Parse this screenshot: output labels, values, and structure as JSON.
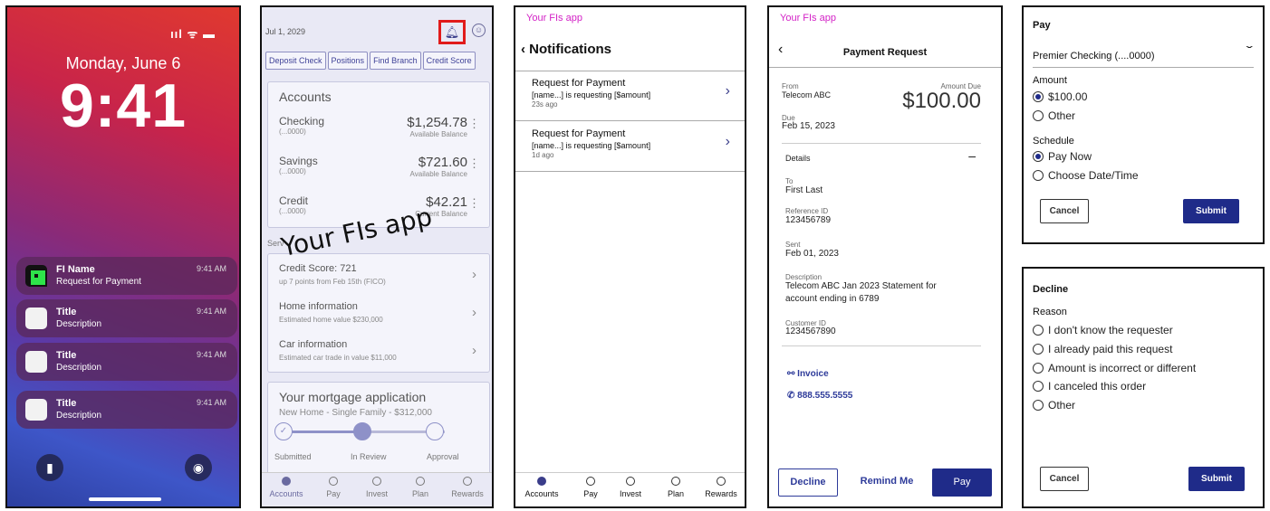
{
  "lock": {
    "status": "ııl ᯤ ▬",
    "date": "Monday, June 6",
    "time": "9:41",
    "notifications": [
      {
        "title": "FI Name",
        "desc": "Request for Payment",
        "time": "9:41 AM"
      },
      {
        "title": "Title",
        "desc": "Description",
        "time": "9:41 AM"
      },
      {
        "title": "Title",
        "desc": "Description",
        "time": "9:41 AM"
      },
      {
        "title": "Title",
        "desc": "Description",
        "time": "9:41 AM"
      }
    ]
  },
  "home": {
    "date": "Jul 1, 2029",
    "chips": [
      "Deposit Check",
      "Positions",
      "Find Branch",
      "Credit Score"
    ],
    "accounts_title": "Accounts",
    "accounts": [
      {
        "name": "Checking",
        "sub": "(...0000)",
        "value": "$1,254.78",
        "label": "Available Balance"
      },
      {
        "name": "Savings",
        "sub": "(...0000)",
        "value": "$721.60",
        "label": "Available Balance"
      },
      {
        "name": "Credit",
        "sub": "(...0000)",
        "value": "$42.21",
        "label": "Current Balance"
      }
    ],
    "services_label": "Serv",
    "services": [
      {
        "name": "Credit Score: 721",
        "sub": "up 7 points from Feb 15th (FICO)"
      },
      {
        "name": "Home information",
        "sub": "Estimated home value $230,000"
      },
      {
        "name": "Car information",
        "sub": "Estimated car trade in value $11,000"
      }
    ],
    "stamp": "Your FIs app",
    "mortgage_title": "Your mortgage application",
    "mortgage_sub": "New Home - Single Family - $312,000",
    "steps": [
      "Submitted",
      "In Review",
      "Approval"
    ],
    "progress": 0.5
  },
  "nav": [
    "Accounts",
    "Pay",
    "Invest",
    "Plan",
    "Rewards"
  ],
  "notifs": {
    "app": "Your FIs app",
    "title": "Notifications",
    "items": [
      {
        "title": "Request for Payment",
        "desc": "[name...] is requesting [$amount]",
        "age": "23s ago"
      },
      {
        "title": "Request for Payment",
        "desc": "[name...] is requesting [$amount]",
        "age": "1d ago"
      }
    ]
  },
  "request": {
    "app": "Your FIs app",
    "title": "Payment Request",
    "from_label": "From",
    "from": "Telecom ABC",
    "amount_label": "Amount Due",
    "amount": "$100.00",
    "due_label": "Due",
    "due": "Feb 15, 2023",
    "details": "Details",
    "to_label": "To",
    "to": "First Last",
    "ref_label": "Reference ID",
    "ref": "123456789",
    "sent_label": "Sent",
    "sent": "Feb 01, 2023",
    "desc_label": "Description",
    "desc1": "Telecom ABC Jan 2023 Statement for",
    "desc2": "account ending in 6789",
    "cust_label": "Customer ID",
    "cust": "1234567890",
    "invoice": "Invoice",
    "phone": "888.555.5555",
    "decline": "Decline",
    "remind": "Remind Me",
    "pay": "Pay"
  },
  "pay": {
    "title": "Pay",
    "account": "Premier Checking (....0000)",
    "amount_label": "Amount",
    "amount_options": [
      "$100.00",
      "Other"
    ],
    "schedule_label": "Schedule",
    "schedule_options": [
      "Pay Now",
      "Choose Date/Time"
    ],
    "cancel": "Cancel",
    "submit": "Submit"
  },
  "decline": {
    "title": "Decline",
    "reason_label": "Reason",
    "options": [
      "I don't know the requester",
      "I already paid this request",
      "Amount is incorrect or different",
      "I canceled this order",
      "Other"
    ],
    "cancel": "Cancel",
    "submit": "Submit"
  }
}
